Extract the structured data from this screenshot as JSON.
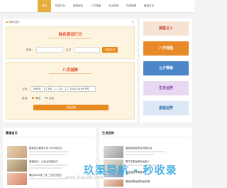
{
  "nav": {
    "tabs": [
      {
        "label": "首页",
        "active": true
      },
      {
        "label": "姓名打分",
        "active": false
      },
      {
        "label": "宝宝起名",
        "active": false
      },
      {
        "label": "八字排盘",
        "active": false
      },
      {
        "label": "吉凶查询",
        "active": false
      },
      {
        "label": "在线抽签",
        "active": false
      },
      {
        "label": "黄道吉日",
        "active": false
      }
    ]
  },
  "location": {
    "text": "请每位客："
  },
  "name_score": {
    "title": "姓名测试打分",
    "surname_label": "姓氏：",
    "given_label": "名字：",
    "button": "开始打分"
  },
  "bazi": {
    "title": "八字测算",
    "calendar_label": "公历：",
    "year": "1990年",
    "month": "6月",
    "day": "1日",
    "hour": "23:00-00:59 子时",
    "gender_label": "性别：",
    "male": "男性",
    "female": "女性",
    "button": "开始测算"
  },
  "banners": [
    {
      "title": "抽签占卜",
      "color": "#c0392b",
      "bg": "#f6e3d2"
    },
    {
      "title": "八字排盘",
      "color": "#ffffff",
      "bg": "#e88a2a"
    },
    {
      "title": "七夕情缘",
      "color": "#ffffff",
      "bg": "#4b86c9"
    },
    {
      "title": "生肖运势",
      "color": "#8e44ad",
      "bg": "#e8d9f0"
    },
    {
      "title": "星座运势",
      "color": "#2c6fb0",
      "bg": "#dce8f5"
    }
  ],
  "huangdao": {
    "title": "黄道吉日",
    "items": [
      {
        "title": "搬家吉日搬家九月 2025年吉日"
      },
      {
        "title": "黄道吉日：大吉大利宜出行"
      },
      {
        "title": "黄历2025年三月二日吉日宜忌"
      }
    ]
  },
  "shengxiao": {
    "title": "生肖运势",
    "items": [
      {
        "title": "属鼠本周运势生肖鼠吉凶"
      },
      {
        "title": "属牛本周运势好运贵人"
      },
      {
        "title": "属虎运势本周提示"
      },
      {
        "title": "属兔本周运势财运亨通"
      }
    ]
  },
  "watermark": {
    "text": "玖渠导航 - 秒收录",
    "url": "www.jiuqudh.com"
  }
}
